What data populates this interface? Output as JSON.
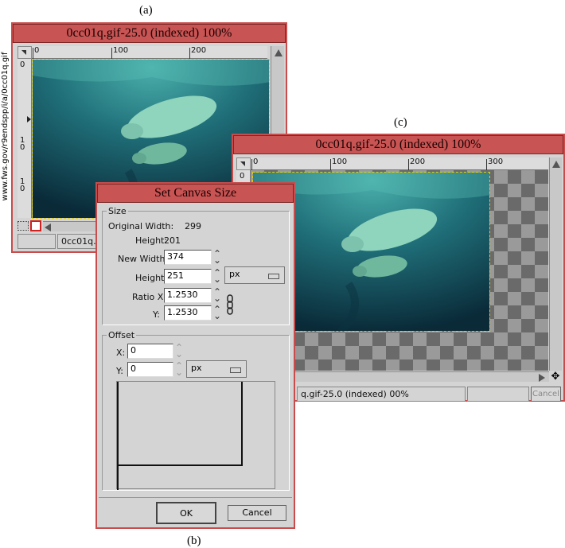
{
  "figure_labels": {
    "a": "(a)",
    "b": "(b)",
    "c": "(c)"
  },
  "side_caption": "www.fws.gov/r9endspp/i/a/0cc01q.gif",
  "window_a": {
    "title": "0cc01q.gif-25.0 (indexed) 100%",
    "ruler_h": [
      "0",
      "100",
      "200"
    ],
    "ruler_v": [
      "0",
      "1 0",
      "1 0"
    ],
    "status": "0cc01q.gif-25.0 (indexed) 100%"
  },
  "window_c": {
    "title": "0cc01q.gif-25.0 (indexed) 100%",
    "ruler_h": [
      "0",
      "100",
      "200",
      "300"
    ],
    "ruler_v": [
      "0"
    ],
    "status": "q.gif-25.0 (indexed) 00%",
    "cancel": "Cancel"
  },
  "dialog": {
    "title": "Set Canvas Size",
    "size_group": "Size",
    "original_width_label": "Original Width:",
    "original_width": "299",
    "height_static_label": "Height:",
    "height_static": "201",
    "new_width_label": "New Width:",
    "new_width": "374",
    "height_label": "Height:",
    "height": "251",
    "unit": "px",
    "ratio_x_label": "Ratio X:",
    "ratio_x": "1.2530",
    "ratio_y_label": "Y:",
    "ratio_y": "1.2530",
    "offset_group": "Offset",
    "offset_x_label": "X:",
    "offset_x": "0",
    "offset_y_label": "Y:",
    "offset_y": "0",
    "offset_unit": "px",
    "ok": "OK",
    "cancel": "Cancel"
  },
  "colors": {
    "title_bar": "#c85454",
    "window_frame": "#c84c4c",
    "water_dark": "#0c2c3c",
    "water_light": "#2a8a8c",
    "manatee": "#9ad8c0"
  }
}
